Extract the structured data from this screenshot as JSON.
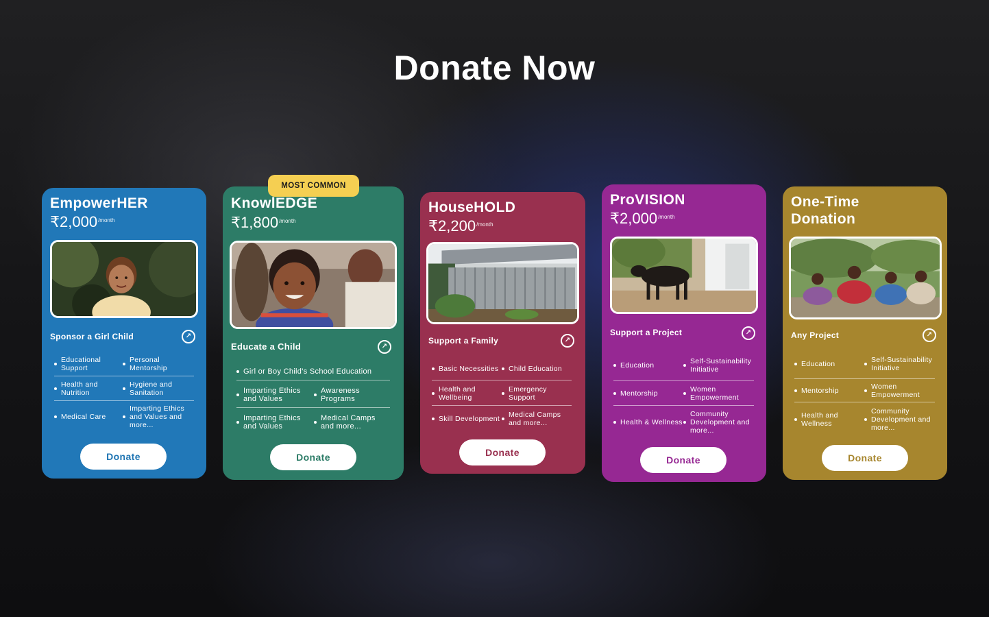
{
  "page": {
    "title": "Donate Now"
  },
  "badge": "MOST COMMON",
  "currency_symbol": "₹",
  "cards": [
    {
      "name": "EmpowerHER",
      "price": "2,000",
      "period": "/month",
      "subtitle": "Sponsor a Girl Child",
      "color": "#2178b8",
      "features": [
        [
          "Educational Support",
          "Personal Mentorship"
        ],
        [
          "Health and Nutrition",
          "Hygiene and Sanitation"
        ],
        [
          "Medical Care",
          "Imparting Ethics and Values and more..."
        ]
      ],
      "button": "Donate",
      "button_color": "#1f75b3"
    },
    {
      "name": "KnowlEDGE",
      "price": "1,800",
      "period": "/month",
      "subtitle": "Educate a Child",
      "color": "#2d7c67",
      "features": [
        [
          "Girl or Boy Child’s School Education"
        ],
        [
          "Imparting Ethics and Values",
          "Awareness Programs"
        ],
        [
          "Imparting Ethics and Values",
          "Medical Camps and more..."
        ]
      ],
      "button": "Donate",
      "button_color": "#2d7c67"
    },
    {
      "name": "HouseHOLD",
      "price": "2,200",
      "period": "/month",
      "subtitle": "Support a Family",
      "color": "#99304f",
      "features": [
        [
          "Basic Necessities",
          "Child Education"
        ],
        [
          "Health and Wellbeing",
          "Emergency Support"
        ],
        [
          "Skill Development",
          "Medical Camps and more..."
        ]
      ],
      "button": "Donate",
      "button_color": "#99304f"
    },
    {
      "name": "ProVISION",
      "price": "2,000",
      "period": "/month",
      "subtitle": "Support a Project",
      "color": "#962893",
      "features": [
        [
          "Education",
          "Self-Sustainability Initiative"
        ],
        [
          "Mentorship",
          "Women Empowerment"
        ],
        [
          "Health & Wellness",
          "Community Development and more..."
        ]
      ],
      "button": "Donate",
      "button_color": "#962893"
    },
    {
      "name": "One-Time Donation",
      "price": "",
      "period": "",
      "subtitle": "Any Project",
      "color": "#a7862e",
      "features": [
        [
          "Education",
          "Self-Sustainability Initiative"
        ],
        [
          "Mentorship",
          "Women Empowerment"
        ],
        [
          "Health and Wellness",
          "Community Development and more..."
        ]
      ],
      "button": "Donate",
      "button_color": "#a7862e"
    }
  ]
}
